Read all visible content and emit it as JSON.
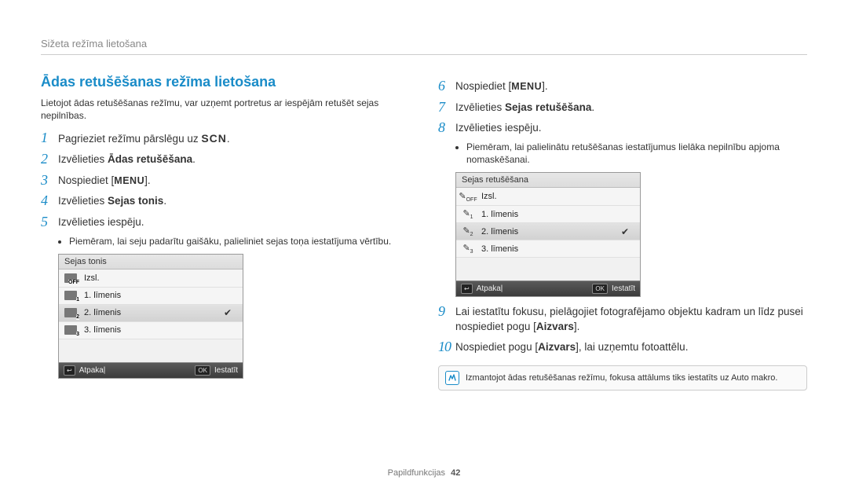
{
  "breadcrumb": "Sižeta režīma lietošana",
  "section_title": "Ādas retušēšanas režīma lietošana",
  "intro": "Lietojot ādas retušēšanas režīmu, var uzņemt portretus ar iespējām retušēt sejas nepilnības.",
  "left": {
    "step1_a": "Pagrieziet režīmu pārslēgu uz ",
    "step1_scn": "SCN",
    "step1_b": ".",
    "step2_a": "Izvēlieties ",
    "step2_bold": "Ādas retušēšana",
    "step2_b": ".",
    "step3_a": "Nospiediet [",
    "step3_menu": "MENU",
    "step3_b": "].",
    "step4_a": "Izvēlieties ",
    "step4_bold": "Sejas tonis",
    "step4_b": ".",
    "step5": "Izvēlieties iespēju.",
    "sub5_bullet": "Piemēram, lai seju padarītu gaišāku, palieliniet sejas toņa iestatījuma vērtību.",
    "panel": {
      "title": "Sejas tonis",
      "items": [
        {
          "label": "Izsl.",
          "sub": "OFF",
          "selected": false
        },
        {
          "label": "1. līmenis",
          "sub": "1",
          "selected": false
        },
        {
          "label": "2. līmenis",
          "sub": "2",
          "selected": true
        },
        {
          "label": "3. līmenis",
          "sub": "3",
          "selected": false
        }
      ],
      "back": "Atpakaļ",
      "set": "Iestatīt",
      "back_key": "↩",
      "set_key": "OK"
    }
  },
  "right": {
    "step6_a": "Nospiediet [",
    "step6_menu": "MENU",
    "step6_b": "].",
    "step7_a": "Izvēlieties ",
    "step7_bold": "Sejas retušēšana",
    "step7_b": ".",
    "step8": "Izvēlieties iespēju.",
    "sub8_bullet": "Piemēram, lai palielinātu retušēšanas iestatījumus lielāka nepilnību apjoma nomaskēšanai.",
    "panel": {
      "title": "Sejas retušēšana",
      "items": [
        {
          "label": "Izsl.",
          "sub": "OFF",
          "selected": false
        },
        {
          "label": "1. līmenis",
          "sub": "1",
          "selected": false
        },
        {
          "label": "2. līmenis",
          "sub": "2",
          "selected": true
        },
        {
          "label": "3. līmenis",
          "sub": "3",
          "selected": false
        }
      ],
      "back": "Atpakaļ",
      "set": "Iestatīt",
      "back_key": "↩",
      "set_key": "OK"
    },
    "step9_a": "Lai iestatītu fokusu, pielāgojiet fotografējamo objektu kadram un līdz pusei nospiediet pogu [",
    "step9_bold": "Aizvars",
    "step9_b": "].",
    "step10_a": "Nospiediet pogu [",
    "step10_bold": "Aizvars",
    "step10_b": "], lai uzņemtu fotoattēlu.",
    "note": "Izmantojot ādas retušēšanas režīmu, fokusa attālums tiks iestatīts uz Auto makro."
  },
  "footer_label": "Papildfunkcijas",
  "footer_page": "42"
}
